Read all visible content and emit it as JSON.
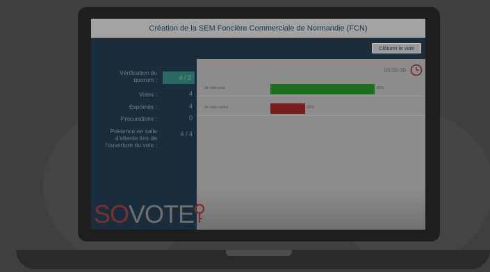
{
  "window": {
    "title": "Création de la SEM Foncière Commerciale de Normandie (FCN)",
    "close_vote_label": "Clôturer le vote"
  },
  "stats": {
    "quorum_label": "Vérification du quorum :",
    "quorum_value": "4 / 2",
    "votes_label": "Votes :",
    "votes_value": "4",
    "exprimes_label": "Exprimés :",
    "exprimes_value": "4",
    "procurations_label": "Procurations :",
    "procurations_value": "0",
    "presence_label": "Présence en salle d'attente lors de l'ouverture du vote :",
    "presence_value": "4 / 4"
  },
  "timer": {
    "value": "00:00:30",
    "icon": "clock-icon"
  },
  "votes": [
    {
      "label": "Je vote pour",
      "percent": 75,
      "percent_label": "75%",
      "color": "#1f6e1f"
    },
    {
      "label": "Je vote contre",
      "percent": 25,
      "percent_label": "25%",
      "color": "#7a1d1d"
    }
  ],
  "logo": {
    "part1": "SO",
    "part2": "VOTE",
    "icon": "key-icon"
  },
  "colors": {
    "quorum_ok": "#2a6a62",
    "accent_red": "#7e2e2e"
  }
}
